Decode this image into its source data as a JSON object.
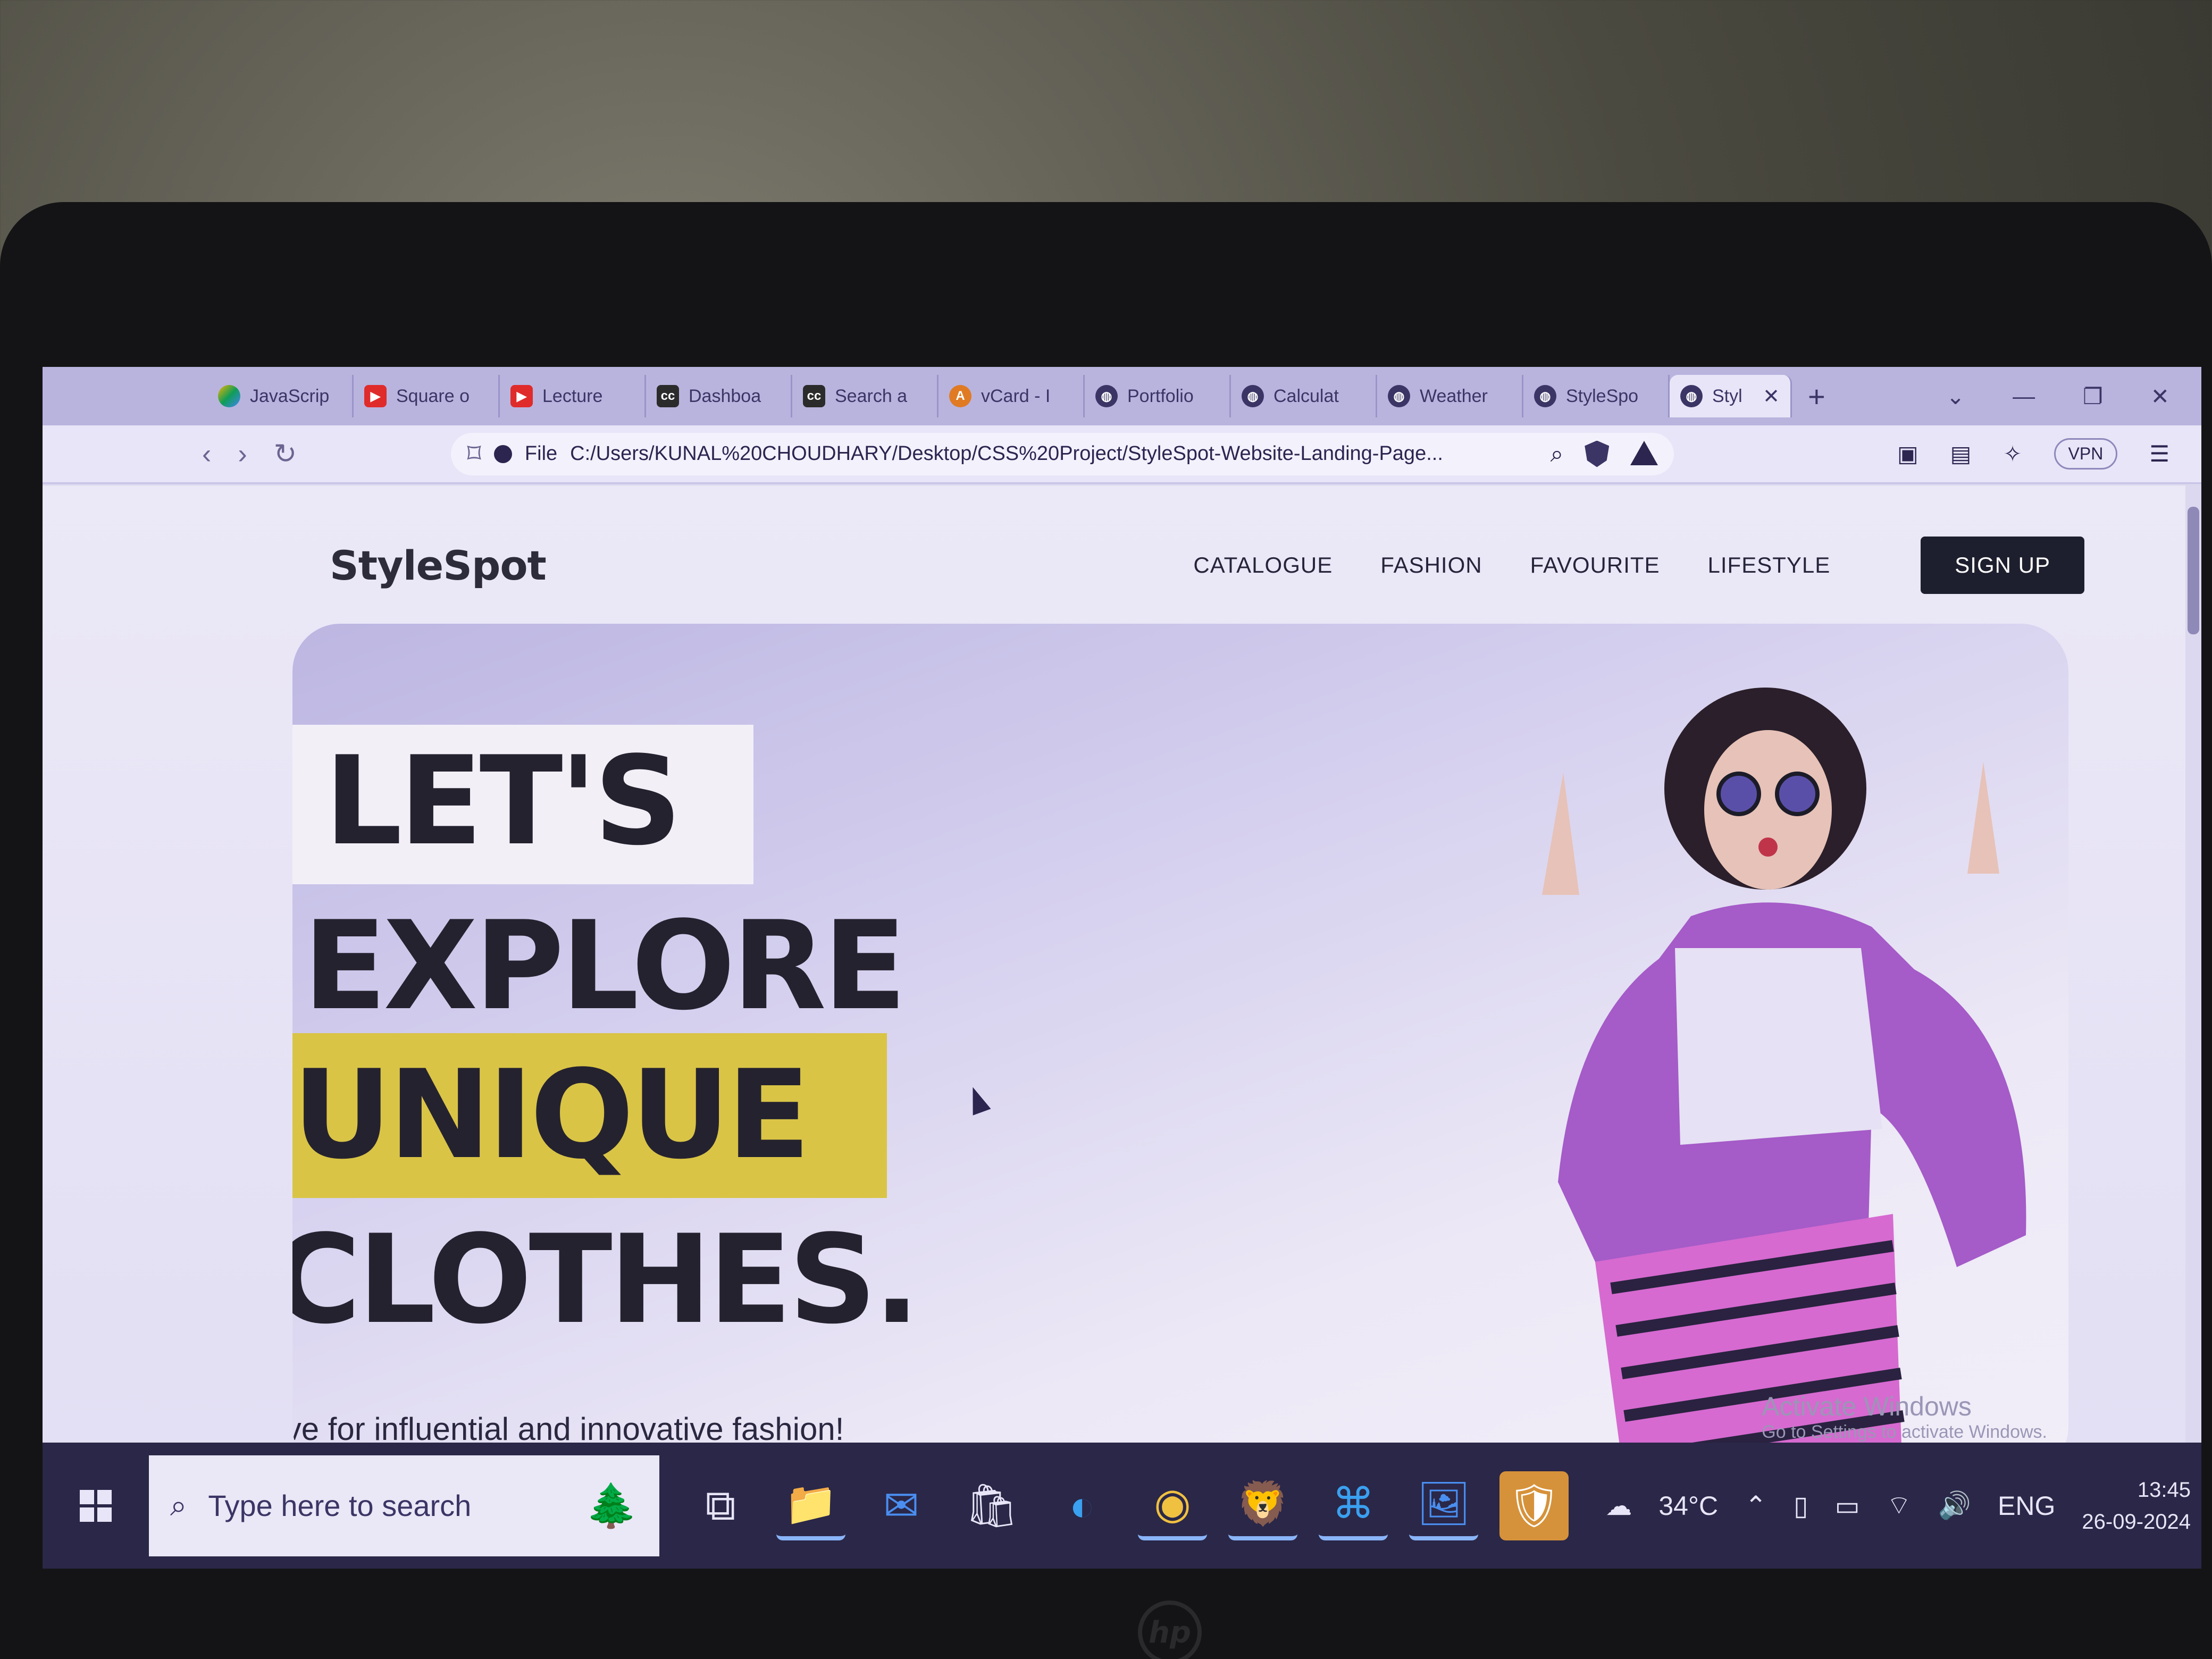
{
  "browser": {
    "tabs": [
      {
        "label": "JavaScrip",
        "icon": "drive-icon"
      },
      {
        "label": "Square o",
        "icon": "youtube-icon"
      },
      {
        "label": "Lecture",
        "icon": "youtube-icon"
      },
      {
        "label": "Dashboa",
        "icon": "cc-icon"
      },
      {
        "label": "Search a",
        "icon": "cc-icon"
      },
      {
        "label": "vCard - I",
        "icon": "vcard-icon"
      },
      {
        "label": "Portfolio",
        "icon": "globe-icon"
      },
      {
        "label": "Calculat",
        "icon": "globe-icon"
      },
      {
        "label": "Weather",
        "icon": "globe-icon"
      },
      {
        "label": "StyleSpo",
        "icon": "globe-icon"
      },
      {
        "label": "Styl",
        "icon": "globe-icon"
      }
    ],
    "address": {
      "scheme": "File",
      "url": "C:/Users/KUNAL%20CHOUDHARY/Desktop/CSS%20Project/StyleSpot-Website-Landing-Page..."
    },
    "vpn_label": "VPN"
  },
  "site": {
    "logo": "StyleSpot",
    "nav": {
      "items": [
        "CATALOGUE",
        "FASHION",
        "FAVOURITE",
        "LIFESTYLE"
      ],
      "signup": "SIGN UP"
    },
    "hero": {
      "lines": [
        "LET'S",
        "EXPLORE",
        "UNIQUE",
        "CLOTHES."
      ],
      "tagline": "Live for influential and innovative fashion!"
    },
    "colors": {
      "accent": "#d9c446",
      "button": "#1e1f2e"
    }
  },
  "watermark": {
    "title": "Activate Windows",
    "subtitle": "Go to Settings to activate Windows."
  },
  "taskbar": {
    "search_placeholder": "Type here to search",
    "weather": "34°C",
    "language": "ENG",
    "time": "13:45",
    "date": "26-09-2024"
  }
}
